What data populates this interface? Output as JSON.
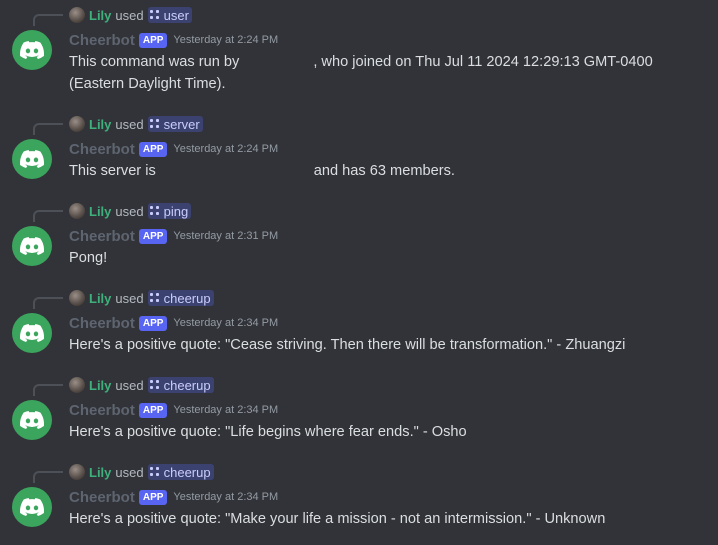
{
  "messages": [
    {
      "reply_user": "Lily",
      "reply_used": "used",
      "command": "user",
      "bot_name": "Cheerbot",
      "badge": "APP",
      "timestamp": "Yesterday at 2:24 PM",
      "content_before": "This command was run by",
      "content_after": ", who joined on Thu Jul 11 2024 12:29:13 GMT-0400 (Eastern Daylight Time)."
    },
    {
      "reply_user": "Lily",
      "reply_used": "used",
      "command": "server",
      "bot_name": "Cheerbot",
      "badge": "APP",
      "timestamp": "Yesterday at 2:24 PM",
      "content_before": "This server is",
      "content_after": "and has 63 members."
    },
    {
      "reply_user": "Lily",
      "reply_used": "used",
      "command": "ping",
      "bot_name": "Cheerbot",
      "badge": "APP",
      "timestamp": "Yesterday at 2:31 PM",
      "content": "Pong!"
    },
    {
      "reply_user": "Lily",
      "reply_used": "used",
      "command": "cheerup",
      "bot_name": "Cheerbot",
      "badge": "APP",
      "timestamp": "Yesterday at 2:34 PM",
      "content": "Here's a positive quote: \"Cease striving. Then there will be transformation.\" - Zhuangzi"
    },
    {
      "reply_user": "Lily",
      "reply_used": "used",
      "command": "cheerup",
      "bot_name": "Cheerbot",
      "badge": "APP",
      "timestamp": "Yesterday at 2:34 PM",
      "content": "Here's a positive quote: \"Life begins where fear ends.\" - Osho"
    },
    {
      "reply_user": "Lily",
      "reply_used": "used",
      "command": "cheerup",
      "bot_name": "Cheerbot",
      "badge": "APP",
      "timestamp": "Yesterday at 2:34 PM",
      "content": "Here's a positive quote: \"Make your life a mission - not an intermission.\" - Unknown"
    }
  ],
  "icons": {
    "avatar": "discord-logo-icon",
    "command": "slash-command-icon",
    "reply_avatar": "user-avatar-icon"
  },
  "colors": {
    "background": "#313338",
    "bot_avatar": "#3ba55d",
    "app_badge": "#5865f2",
    "reply_user": "#3fb07c",
    "command_pill": "#3c4270"
  }
}
